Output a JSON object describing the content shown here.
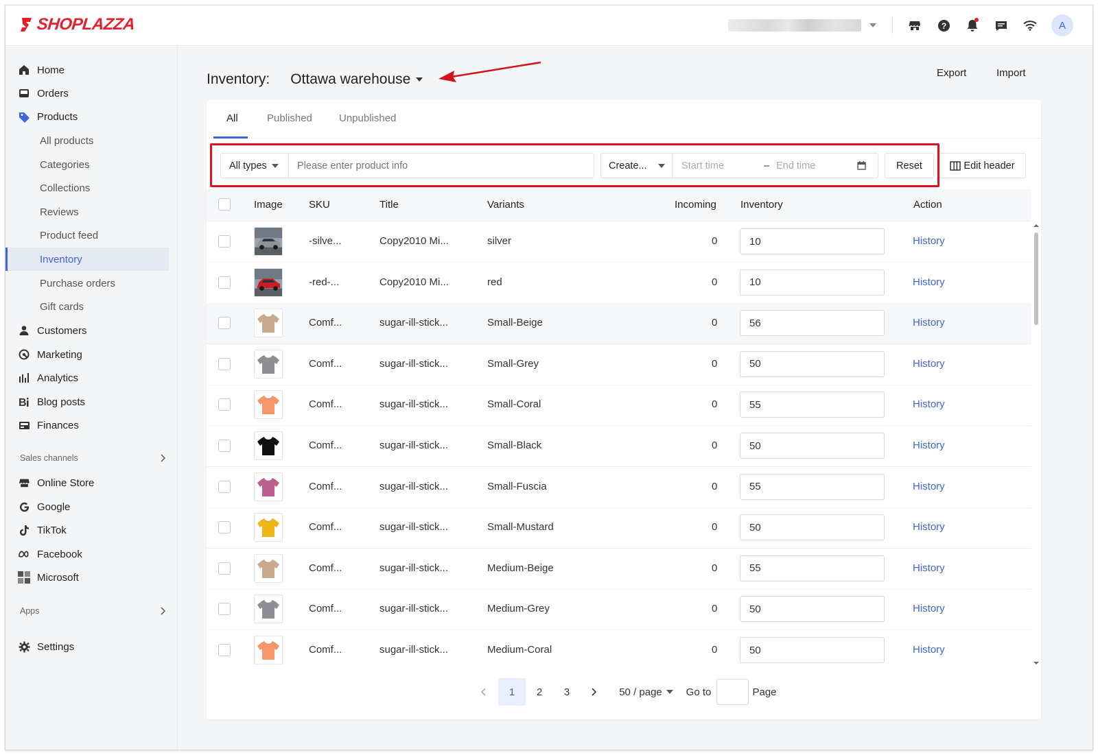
{
  "brand": {
    "logo_text": "SHOPLAZZA",
    "color": "#e5202e"
  },
  "topbar": {
    "icons": [
      "store-icon",
      "help-icon",
      "bell-icon",
      "chat-icon",
      "wifi-icon"
    ],
    "avatar_initial": "A"
  },
  "sidebar": {
    "items": [
      {
        "label": "Home",
        "icon": "home-icon"
      },
      {
        "label": "Orders",
        "icon": "orders-icon"
      },
      {
        "label": "Products",
        "icon": "tag-icon"
      }
    ],
    "product_subitems": [
      "All products",
      "Categories",
      "Collections",
      "Reviews",
      "Product feed",
      "Inventory",
      "Purchase orders",
      "Gift cards"
    ],
    "active_subitem": "Inventory",
    "items_after": [
      {
        "label": "Customers",
        "icon": "person-icon"
      },
      {
        "label": "Marketing",
        "icon": "marketing-icon"
      },
      {
        "label": "Analytics",
        "icon": "bar-chart-icon"
      },
      {
        "label": "Blog posts",
        "icon": "blog-icon"
      },
      {
        "label": "Finances",
        "icon": "finances-icon"
      }
    ],
    "sales_channels_label": "Sales channels",
    "channels": [
      {
        "label": "Online Store",
        "icon": "store-icon"
      },
      {
        "label": "Google",
        "icon": "google-icon"
      },
      {
        "label": "TikTok",
        "icon": "tiktok-icon"
      },
      {
        "label": "Facebook",
        "icon": "meta-icon"
      },
      {
        "label": "Microsoft",
        "icon": "microsoft-icon"
      }
    ],
    "apps_label": "Apps",
    "settings_label": "Settings"
  },
  "page": {
    "title": "Inventory:",
    "warehouse": "Ottawa warehouse",
    "export_label": "Export",
    "import_label": "Import"
  },
  "tabs": [
    "All",
    "Published",
    "Unpublished"
  ],
  "filters": {
    "type_value": "All types",
    "search_placeholder": "Please enter product info",
    "date_field_value": "Create...",
    "start_placeholder": "Start time",
    "range_sep": "–",
    "end_placeholder": "End time",
    "reset_label": "Reset",
    "edit_header_label": "Edit header"
  },
  "table": {
    "headers": {
      "image": "Image",
      "sku": "SKU",
      "title": "Title",
      "variants": "Variants",
      "incoming": "Incoming",
      "inventory": "Inventory",
      "action": "Action"
    },
    "action_label": "History",
    "rows": [
      {
        "sku": "-silve...",
        "title": "Copy2010 Mi...",
        "variant": "silver",
        "incoming": "0",
        "inventory": "10",
        "thumb": "car-silver",
        "color": "#8d949c"
      },
      {
        "sku": "-red-...",
        "title": "Copy2010 Mi...",
        "variant": "red",
        "incoming": "0",
        "inventory": "10",
        "thumb": "car-red",
        "color": "#c81e25"
      },
      {
        "sku": "Comf...",
        "title": "sugar-ill-stick...",
        "variant": "Small-Beige",
        "incoming": "0",
        "inventory": "56",
        "thumb": "tshirt",
        "color": "#c9a98b"
      },
      {
        "sku": "Comf...",
        "title": "sugar-ill-stick...",
        "variant": "Small-Grey",
        "incoming": "0",
        "inventory": "50",
        "thumb": "tshirt",
        "color": "#8e8e94"
      },
      {
        "sku": "Comf...",
        "title": "sugar-ill-stick...",
        "variant": "Small-Coral",
        "incoming": "0",
        "inventory": "55",
        "thumb": "tshirt",
        "color": "#f5966b"
      },
      {
        "sku": "Comf...",
        "title": "sugar-ill-stick...",
        "variant": "Small-Black",
        "incoming": "0",
        "inventory": "50",
        "thumb": "tshirt",
        "color": "#111111"
      },
      {
        "sku": "Comf...",
        "title": "sugar-ill-stick...",
        "variant": "Small-Fuscia",
        "incoming": "0",
        "inventory": "55",
        "thumb": "tshirt",
        "color": "#b9608f"
      },
      {
        "sku": "Comf...",
        "title": "sugar-ill-stick...",
        "variant": "Small-Mustard",
        "incoming": "0",
        "inventory": "50",
        "thumb": "tshirt",
        "color": "#efb417"
      },
      {
        "sku": "Comf...",
        "title": "sugar-ill-stick...",
        "variant": "Medium-Beige",
        "incoming": "0",
        "inventory": "55",
        "thumb": "tshirt",
        "color": "#c9a98b"
      },
      {
        "sku": "Comf...",
        "title": "sugar-ill-stick...",
        "variant": "Medium-Grey",
        "incoming": "0",
        "inventory": "50",
        "thumb": "tshirt",
        "color": "#8e8e94"
      },
      {
        "sku": "Comf...",
        "title": "sugar-ill-stick...",
        "variant": "Medium-Coral",
        "incoming": "0",
        "inventory": "50",
        "thumb": "tshirt",
        "color": "#f5966b"
      }
    ]
  },
  "pagination": {
    "pages": [
      "1",
      "2",
      "3"
    ],
    "current": "1",
    "page_size": "50 / page",
    "goto_label": "Go to",
    "page_label": "Page"
  },
  "colors": {
    "accent": "#3d66d9",
    "highlight": "#e0101f",
    "annotation": "#d4111c"
  }
}
